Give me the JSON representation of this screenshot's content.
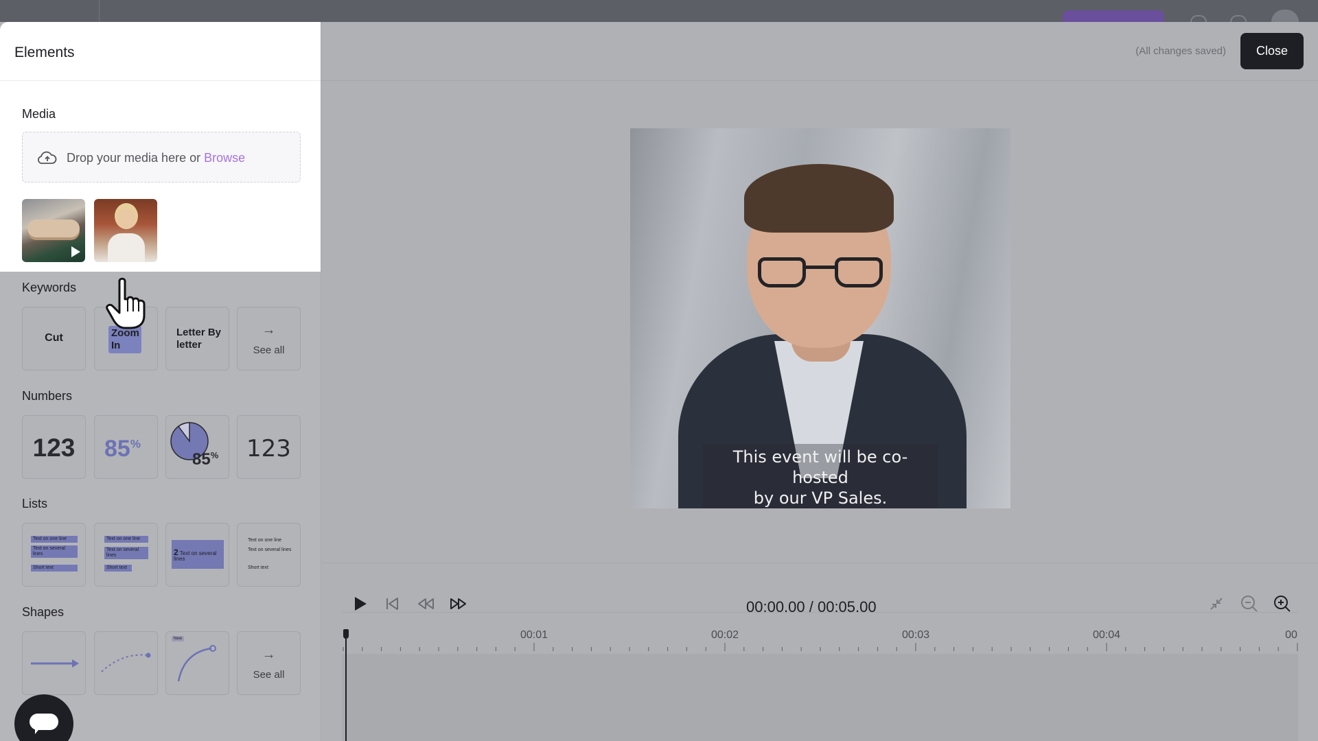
{
  "panel": {
    "title": "Elements",
    "media": {
      "label": "Media",
      "drop_text": "Drop your media here or ",
      "browse_label": "Browse"
    },
    "keywords": {
      "label": "Keywords",
      "items": [
        "Cut",
        "Zoom In",
        "Letter By letter"
      ],
      "see_all": "See all"
    },
    "numbers": {
      "label": "Numbers",
      "items": [
        "123",
        "85",
        "85",
        "123"
      ],
      "pct_symbol": "%"
    },
    "lists": {
      "label": "Lists",
      "line_one": "Text on one line",
      "line_several": "Text on several lines",
      "line_short": "Short text",
      "numbered_index": "2"
    },
    "shapes": {
      "label": "Shapes",
      "new_badge": "New",
      "see_all": "See all"
    }
  },
  "header": {
    "saved_status": "(All changes saved)",
    "close_label": "Close"
  },
  "preview": {
    "caption_line1": "This event will be co-hosted",
    "caption_line2": "by our VP Sales."
  },
  "player": {
    "time_readout": "00:00.00 / 00:05.00",
    "ticks": [
      "00:01",
      "00:02",
      "00:03",
      "00:04",
      "00"
    ]
  },
  "icons": {
    "upload": "cloud-upload-icon",
    "play": "play-icon",
    "skip_start": "skip-to-start-icon",
    "rewind": "rewind-icon",
    "fast_forward": "fast-forward-icon",
    "fit": "fit-to-screen-icon",
    "zoom_out": "zoom-out-icon",
    "zoom_in": "zoom-in-icon",
    "chat": "chat-icon"
  },
  "colors": {
    "accent": "#a673e0",
    "primary_dark": "#1d1f24",
    "tile_highlight": "#7479b4"
  }
}
